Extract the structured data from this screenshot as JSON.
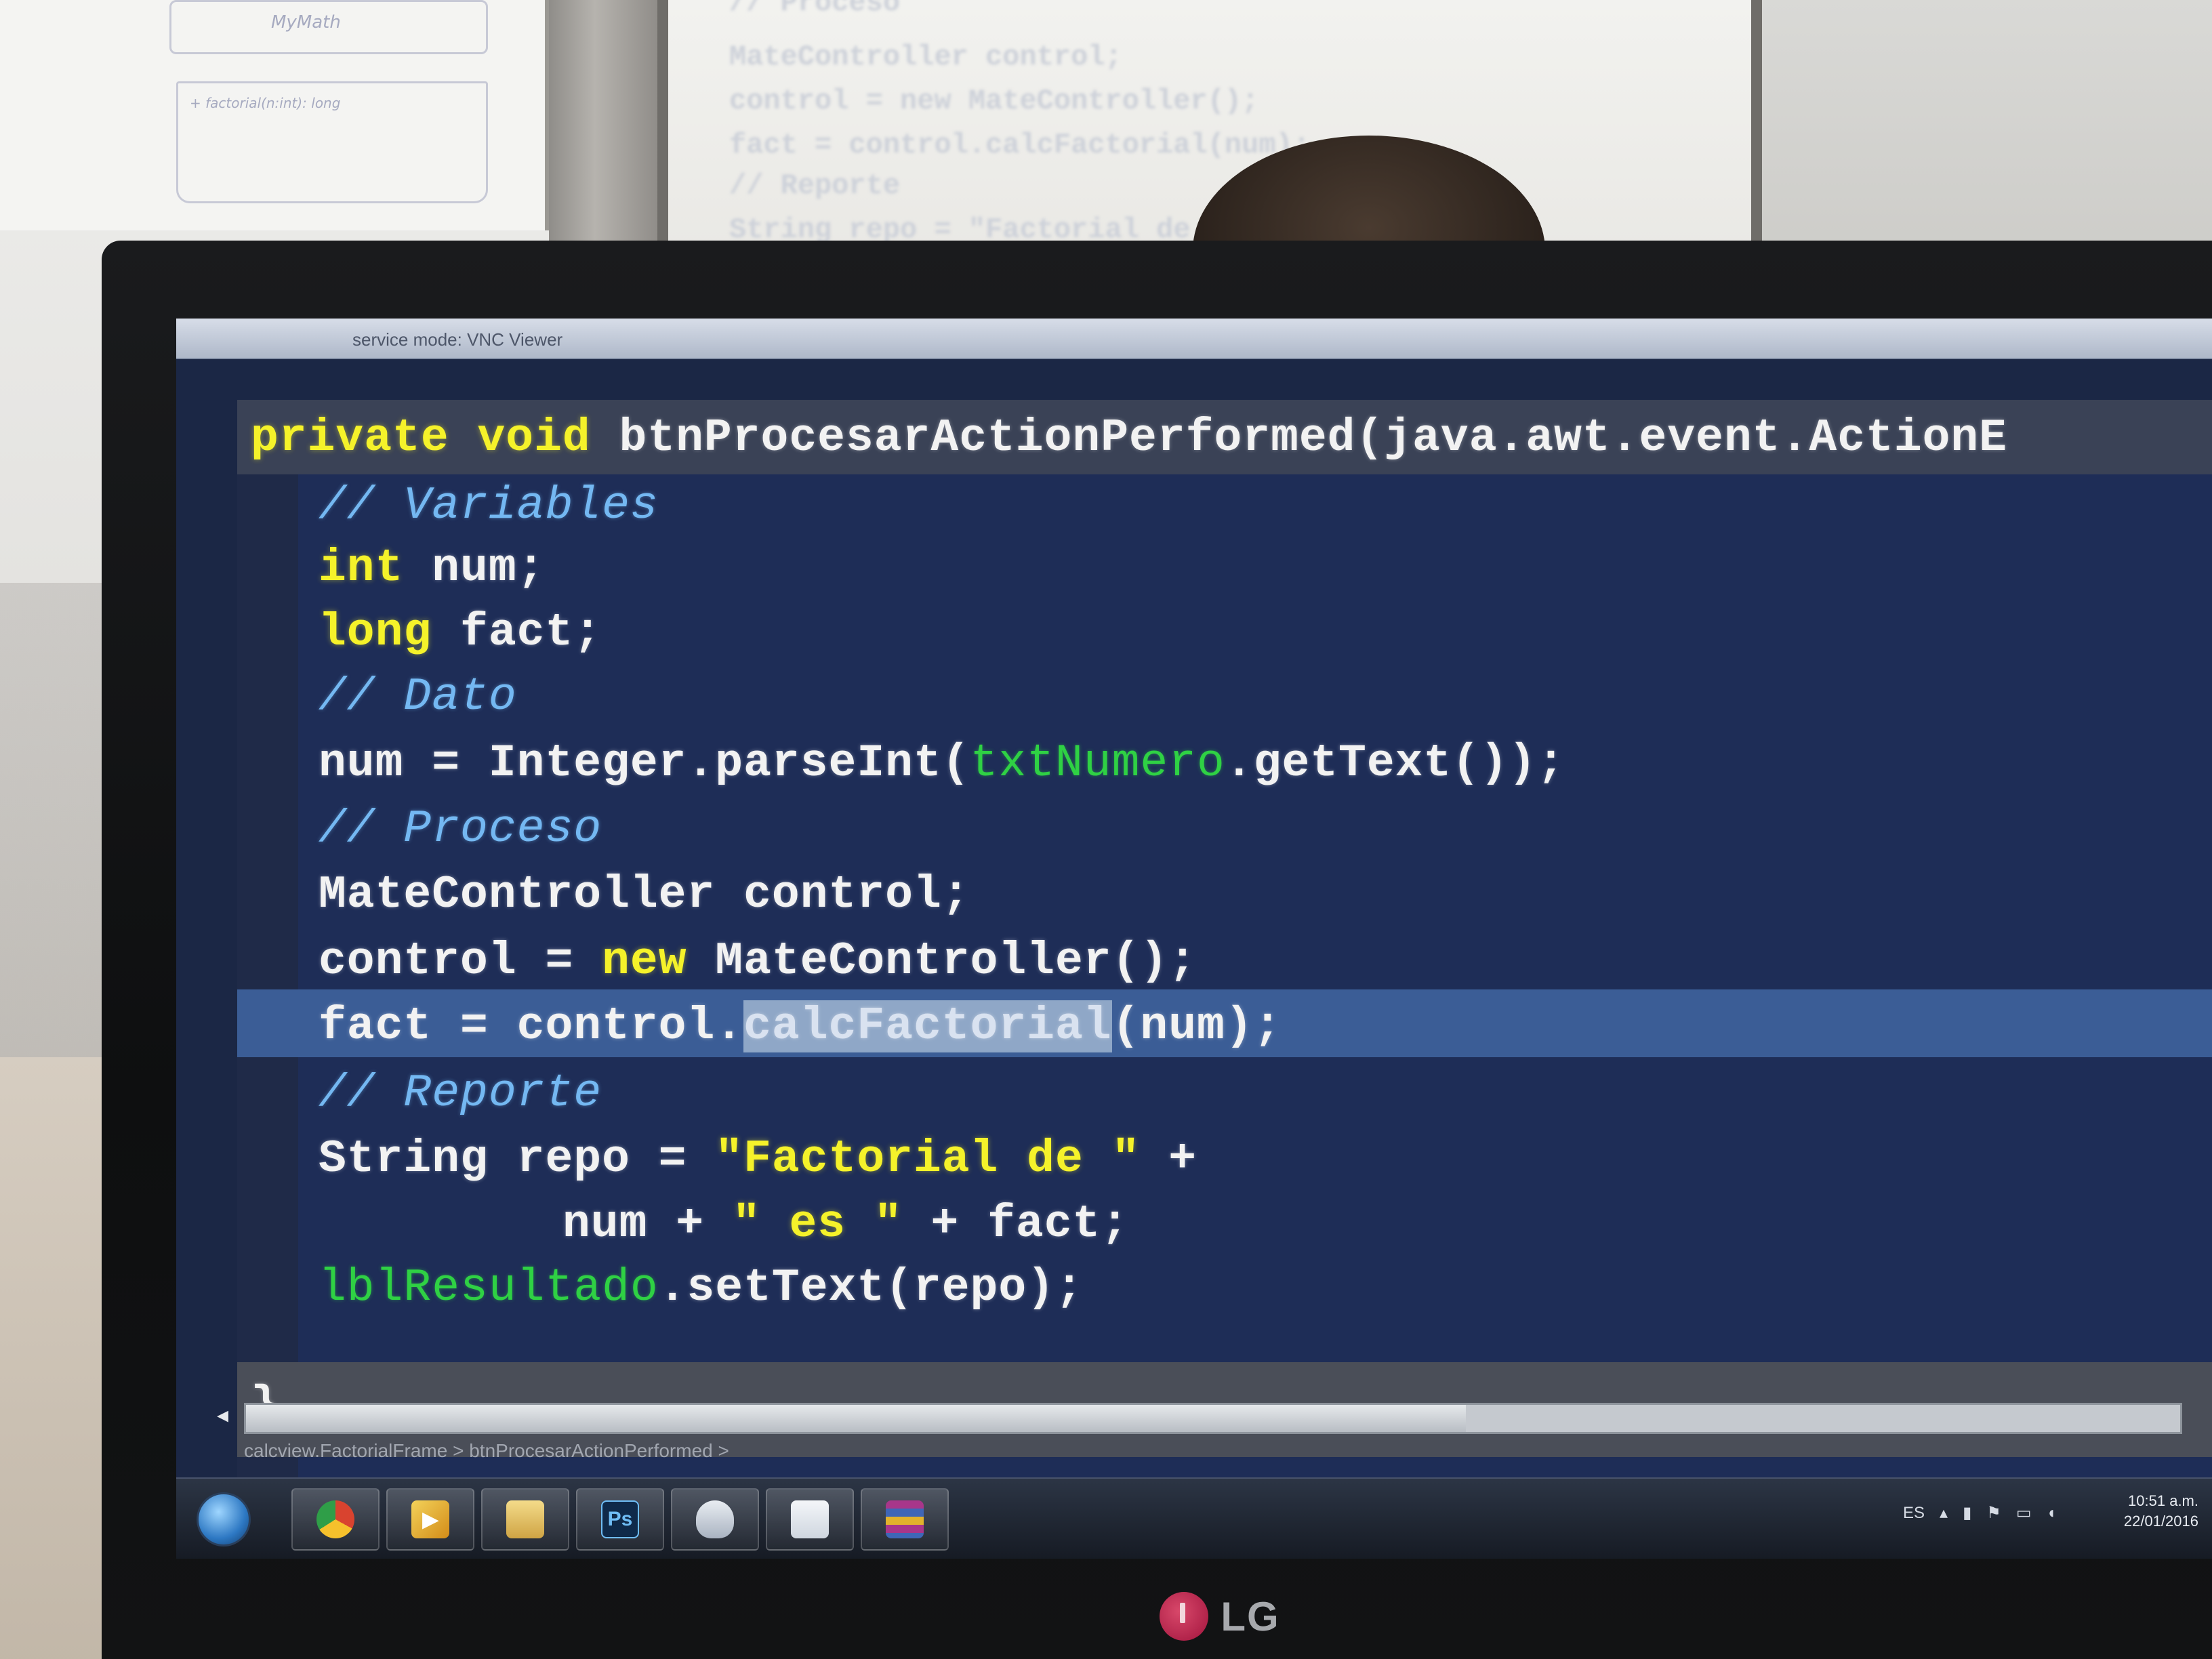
{
  "scene": {
    "projector_lines": [
      "// Proceso",
      "MateController control;",
      "control = new MateController();",
      "fact = control.calcFactorial(num);",
      "// Reporte",
      "String repo = \"Factorial de \" +"
    ],
    "whiteboard_text": [
      "MyMath",
      "+ factorial(n:int): long"
    ]
  },
  "vnc": {
    "title": "service mode: VNC Viewer"
  },
  "editor": {
    "method_keyword1": "private",
    "method_keyword2": "void",
    "method_signature": "btnProcesarActionPerformed(java.awt.event.ActionE",
    "comment_variables": "// Variables",
    "type_int": "int",
    "var_num_decl": " num;",
    "type_long": "long",
    "var_fact_decl": " fact;",
    "comment_dato": "// Dato",
    "line_parse_prefix": "num = Integer.parseInt(",
    "field_txt": "txtNumero",
    "line_parse_suffix": ".getText());",
    "comment_proceso": "// Proceso",
    "line_declare_control": "MateController control;",
    "line_new_prefix": "control = ",
    "kw_new": "new",
    "line_new_suffix": " MateController();",
    "line_fact_prefix": "fact = control.",
    "highlight_word": "calcFactorial",
    "line_fact_suffix": "(num);",
    "comment_reporte": "// Reporte",
    "line_repo_prefix": "String repo = ",
    "string_factorial": "\"Factorial de \"",
    "line_repo_suffix": " +",
    "line_cont_prefix": "num + ",
    "string_es": "\" es \"",
    "line_cont_suffix": " + fact;",
    "field_lbl": "lblResultado",
    "line_settext_suffix": ".setText(repo);",
    "closing_brace": "}",
    "breadcrumb": "calcview.FactorialFrame  >  btnProcesarActionPerformed  >"
  },
  "taskbar": {
    "apps": [
      {
        "name": "chrome",
        "label": ""
      },
      {
        "name": "media-player",
        "label": ""
      },
      {
        "name": "folder",
        "label": ""
      },
      {
        "name": "photoshop",
        "label": "Ps"
      },
      {
        "name": "app-shield",
        "label": ""
      },
      {
        "name": "blank",
        "label": ""
      },
      {
        "name": "winrar",
        "label": ""
      }
    ],
    "language": "ES",
    "time": "10:51 a.m.",
    "date": "22/01/2016"
  },
  "monitor": {
    "brand": "LG"
  },
  "colors": {
    "keyword": "#f5f22a",
    "comment": "#74b8f2",
    "field": "#2fd144",
    "editor_bg": "#1e2d57",
    "highlight_line": "#3b5d96"
  }
}
